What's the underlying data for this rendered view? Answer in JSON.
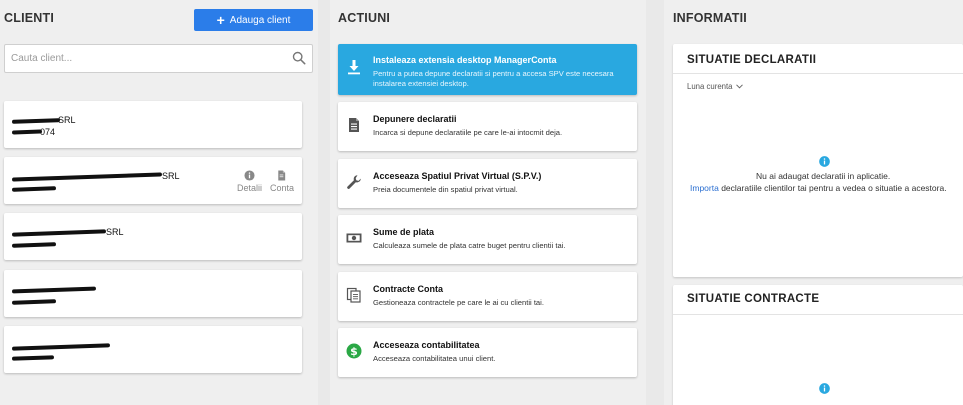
{
  "clients": {
    "title": "CLIENTI",
    "add_button": "Adauga client",
    "search_placeholder": "Cauta client...",
    "items": [
      {
        "name": "SRL",
        "code": "074"
      },
      {
        "name": "SRL",
        "code": ""
      },
      {
        "name": "SRL",
        "code": ""
      },
      {
        "name": "",
        "code": ""
      },
      {
        "name": "",
        "code": ""
      }
    ],
    "actions": {
      "details": "Detalii",
      "conta": "Conta"
    }
  },
  "actions": {
    "title": "ACTIUNI",
    "items": [
      {
        "title": "Instaleaza extensia desktop ManagerConta",
        "desc": "Pentru a putea depune declaratii si pentru a accesa SPV este necesara instalarea extensiei desktop.",
        "icon": "download-icon"
      },
      {
        "title": "Depunere declaratii",
        "desc": "Incarca si depune declaratiile pe care le-ai intocmit deja.",
        "icon": "document-icon"
      },
      {
        "title": "Acceseaza Spatiul Privat Virtual (S.P.V.)",
        "desc": "Preia documentele din spatiul privat virtual.",
        "icon": "wrench-icon"
      },
      {
        "title": "Sume de plata",
        "desc": "Calculeaza sumele de plata catre buget pentru clientii tai.",
        "icon": "money-icon"
      },
      {
        "title": "Contracte Conta",
        "desc": "Gestioneaza contractele pe care le ai cu clientii tai.",
        "icon": "contracts-icon"
      },
      {
        "title": "Acceseaza contabilitatea",
        "desc": "Acceseaza contabilitatea unui client.",
        "icon": "dollar-icon"
      }
    ]
  },
  "info": {
    "title": "INFORMATII",
    "declarations": {
      "title": "SITUATIE DECLARATII",
      "period": "Luna curenta",
      "empty_line1": "Nu ai adaugat declaratii in aplicatie.",
      "empty_link": "Importa",
      "empty_line2": " declaratiile clientilor tai pentru a vedea o situatie a acestora."
    },
    "contracts": {
      "title": "SITUATIE CONTRACTE"
    }
  },
  "colors": {
    "primary_button": "#2b7de9",
    "action_highlight": "#29a8e0",
    "info_icon": "#29a8e0",
    "dollar_green": "#2aa845"
  }
}
